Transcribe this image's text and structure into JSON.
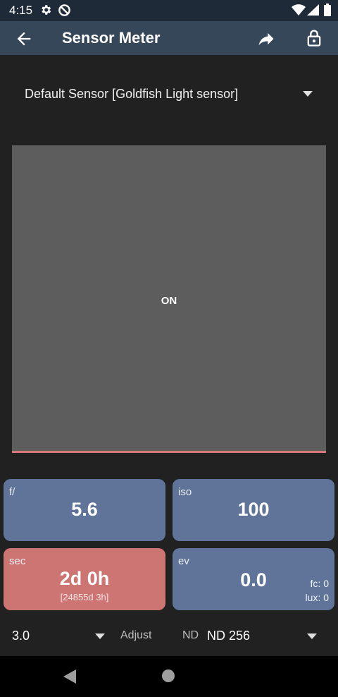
{
  "status_bar": {
    "time": "4:15"
  },
  "toolbar": {
    "title": "Sensor Meter"
  },
  "sensor": {
    "selected": "Default Sensor [Goldfish Light sensor]"
  },
  "meter": {
    "state": "ON"
  },
  "tiles": {
    "aperture": {
      "label": "f/",
      "value": "5.6"
    },
    "iso": {
      "label": "iso",
      "value": "100"
    },
    "shutter": {
      "label": "sec",
      "value": "2d 0h",
      "sub": "[24855d 3h]"
    },
    "ev": {
      "label": "ev",
      "value": "0.0",
      "fc": "fc: 0",
      "lux": "lux: 0"
    }
  },
  "controls": {
    "adjust_value": "3.0",
    "adjust_label": "Adjust",
    "nd_label": "ND",
    "nd_value": "ND 256"
  },
  "colors": {
    "toolbar": "#37475a",
    "tile_blue": "#5f7498",
    "tile_red": "#cd7572",
    "meter_bg": "#5d5d5d"
  }
}
